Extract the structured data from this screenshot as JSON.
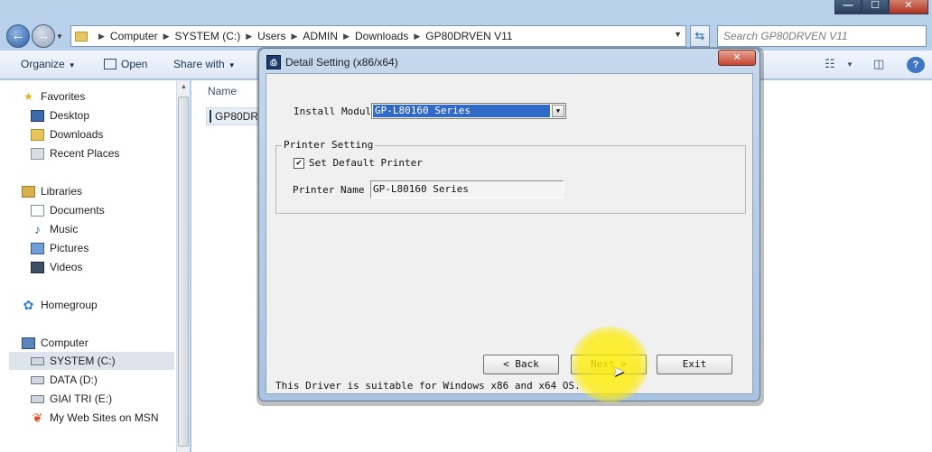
{
  "window_controls": {
    "minimize": "—",
    "maximize": "☐",
    "close": "✕"
  },
  "address": {
    "crumbs": [
      "Computer",
      "SYSTEM (C:)",
      "Users",
      "ADMIN",
      "Downloads",
      "GP80DRVEN V11"
    ],
    "search_placeholder": "Search GP80DRVEN V11"
  },
  "toolbar": {
    "organize": "Organize",
    "open": "Open",
    "share_with": "Share with"
  },
  "navpane": {
    "favorites": "Favorites",
    "desktop": "Desktop",
    "downloads": "Downloads",
    "recent_places": "Recent Places",
    "libraries": "Libraries",
    "documents": "Documents",
    "music": "Music",
    "pictures": "Pictures",
    "videos": "Videos",
    "homegroup": "Homegroup",
    "computer": "Computer",
    "system_c": "SYSTEM (C:)",
    "data_d": "DATA (D:)",
    "giai_tri_e": "GIAI TRI (E:)",
    "msn": "My Web Sites on MSN"
  },
  "content": {
    "column_name": "Name",
    "file_name": "GP80DRVEN V11"
  },
  "dialog": {
    "title": "Detail Setting (x86/x64)",
    "close": "✕",
    "install_module_label": "Install Module",
    "install_module_value": "GP-L80160 Series",
    "printer_setting_legend": "Printer Setting",
    "set_default_label": "Set Default Printer",
    "set_default_checked": "✔",
    "printer_name_label": "Printer Name",
    "printer_name_value": "GP-L80160 Series",
    "back_label": "< Back",
    "next_label": "Next >",
    "exit_label": "Exit",
    "footer": "This Driver is suitable for Windows x86 and x64 OS."
  }
}
